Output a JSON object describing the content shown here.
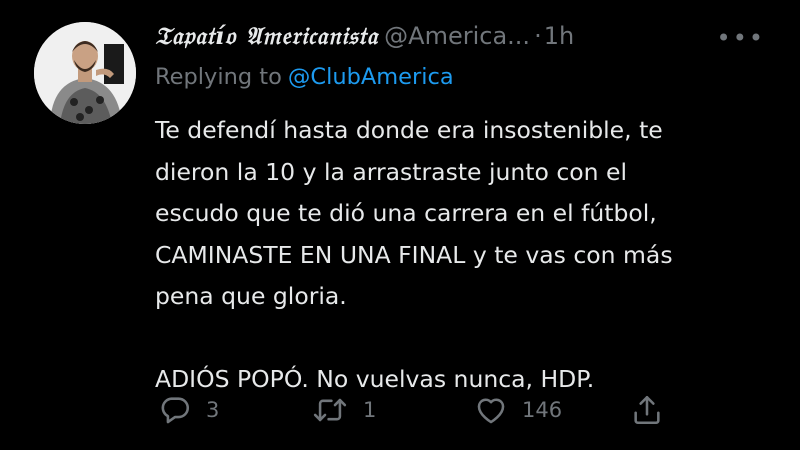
{
  "tweet": {
    "display_name": "𝔗𝔞𝔭𝔞𝔱í𝔬 𝔄𝔪𝔢𝔯𝔦𝔠𝔞𝔫𝔦𝔰𝔱𝔞",
    "handle": "@America...",
    "separator": "·",
    "time": "1h",
    "more_icon": "more-horizontal-icon",
    "reply_prefix": "Replying to",
    "reply_target": "@ClubAmerica",
    "body_lines": [
      "Te defendí hasta donde era insostenible, te",
      "dieron la 10 y la arrastraste junto con el",
      "escudo que te dió una carrera en el fútbol,",
      "CAMINASTE EN UNA FINAL y te vas con más",
      "pena que gloria.",
      "",
      "ADIÓS POPÓ. No vuelvas nunca, HDP."
    ],
    "actions": {
      "reply": {
        "icon": "reply-icon",
        "count": "3"
      },
      "retweet": {
        "icon": "retweet-icon",
        "count": "1"
      },
      "like": {
        "icon": "heart-icon",
        "count": "146"
      },
      "share": {
        "icon": "share-icon",
        "count": ""
      }
    }
  },
  "colors": {
    "background": "#000000",
    "text_primary": "#e7e9ea",
    "text_secondary": "#71767b",
    "link": "#1d9bf0"
  }
}
